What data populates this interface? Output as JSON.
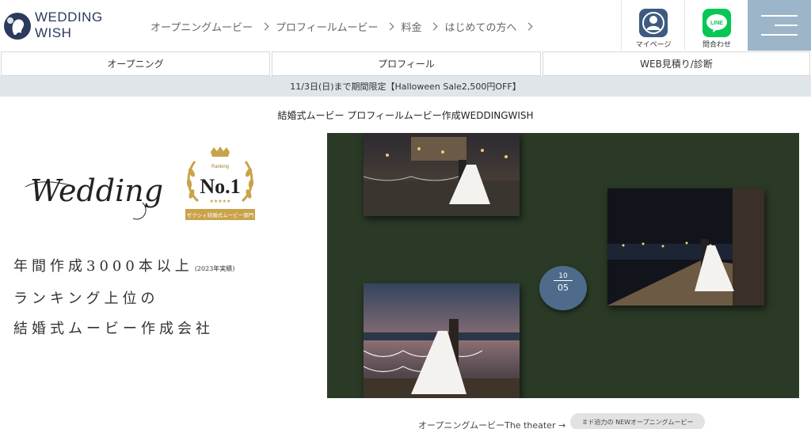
{
  "brand": {
    "line1": "WEDDING",
    "line2": "WISH"
  },
  "header": {
    "nav": [
      {
        "label": "オープニングムービー"
      },
      {
        "label": "プロフィールムービー"
      },
      {
        "label": "料金"
      },
      {
        "label": "はじめての方へ"
      }
    ],
    "mypage_label": "マイページ",
    "line_label": "問合わせ",
    "line_icon_text": "LINE"
  },
  "subnav": {
    "items": [
      {
        "label": "オープニング"
      },
      {
        "label": "プロフィール"
      },
      {
        "label": "WEB見積り/診断"
      }
    ]
  },
  "banner": {
    "text": "11/3日(日)まで期間限定【Halloween Sale2,500円OFF】"
  },
  "tagline": "結婚式ムービー プロフィールムービー作成WEDDINGWISH",
  "hero": {
    "script_text": "Wedding",
    "badge": {
      "ranking": "Ranking",
      "no1": "No.1",
      "stars": "★★★★★",
      "ribbon": "ゼクシィ結婚式ムービー部門"
    },
    "copy_line1": "年間作成3000本以上",
    "copy_note": "(2023年実績)",
    "copy_line2": "ランキング上位の",
    "copy_line3": "結婚式ムービー作成会社",
    "calendar_top": "10",
    "calendar_bottom": "05"
  },
  "links": {
    "theater": "オープニングムービーThe theater →",
    "pill": "＃ド迫力の NEWオープニングムービー"
  },
  "colors": {
    "brand_navy": "#2b3b5c",
    "menu_bg": "#9cb5c8",
    "banner_bg": "#dfe5e8",
    "line_green": "#06c755",
    "mypage_blue": "#3d5a80",
    "stage_green": "#2a3a26"
  }
}
